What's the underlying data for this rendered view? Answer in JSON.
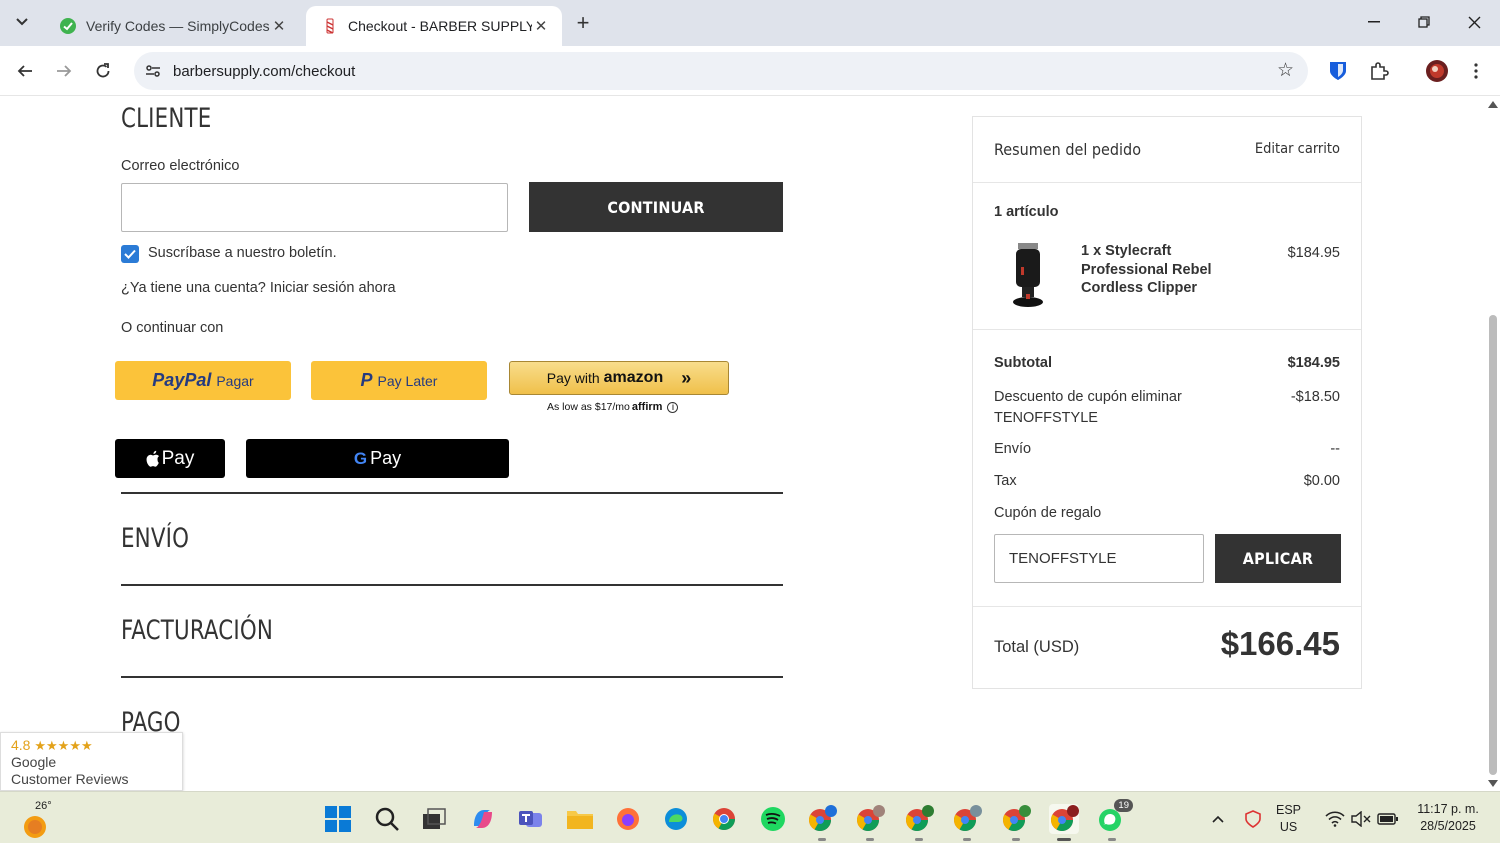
{
  "browser": {
    "tabs": [
      {
        "title": "Verify Codes — SimplyCodes",
        "active": false
      },
      {
        "title": "Checkout - BARBER SUPPLY",
        "active": true
      }
    ],
    "url": "barbersupply.com/checkout"
  },
  "customer": {
    "heading": "CLIENTE",
    "email_label": "Correo electrónico",
    "email_value": "",
    "continue_label": "CONTINUAR",
    "newsletter_label": "Suscríbase a nuestro boletín.",
    "newsletter_checked": true,
    "login_prompt": "¿Ya tiene una cuenta? Iniciar sesión ahora",
    "or_continue": "O continuar con"
  },
  "payment_options": {
    "paypal_brand": "PayPal",
    "paypal_label": "Pagar",
    "paylater_label": "Pay Later",
    "amazon_label": "Pay with",
    "amazon_brand": "amazon",
    "affirm_text": "As low as $17/mo",
    "affirm_brand": "affirm",
    "applepay_label": "Pay",
    "gpay_label": "Pay"
  },
  "sections": {
    "shipping": "ENVÍO",
    "billing": "FACTURACIÓN",
    "payment": "PAGO"
  },
  "summary": {
    "title": "Resumen del pedido",
    "edit_cart": "Editar carrito",
    "item_count": "1 artículo",
    "item_name": "1 x Stylecraft Professional Rebel Cordless Clipper",
    "item_price": "$184.95",
    "subtotal_label": "Subtotal",
    "subtotal_value": "$184.95",
    "discount_label": "Descuento de cupón eliminar",
    "discount_code": "TENOFFSTYLE",
    "discount_value": "-$18.50",
    "shipping_label": "Envío",
    "shipping_value": "--",
    "tax_label": "Tax",
    "tax_value": "$0.00",
    "gift_label": "Cupón de regalo",
    "gift_input_value": "TENOFFSTYLE",
    "apply_label": "APLICAR",
    "total_label": "Total (USD)",
    "total_value": "$166.45"
  },
  "google_badge": {
    "rating": "4.8",
    "stars": "★★★★★",
    "line1": "Google",
    "line2": "Customer Reviews"
  },
  "taskbar": {
    "weather": "26°",
    "lang1": "ESP",
    "lang2": "US",
    "time": "11:17 p. m.",
    "date": "28/5/2025",
    "whatsapp_badge": "19"
  }
}
